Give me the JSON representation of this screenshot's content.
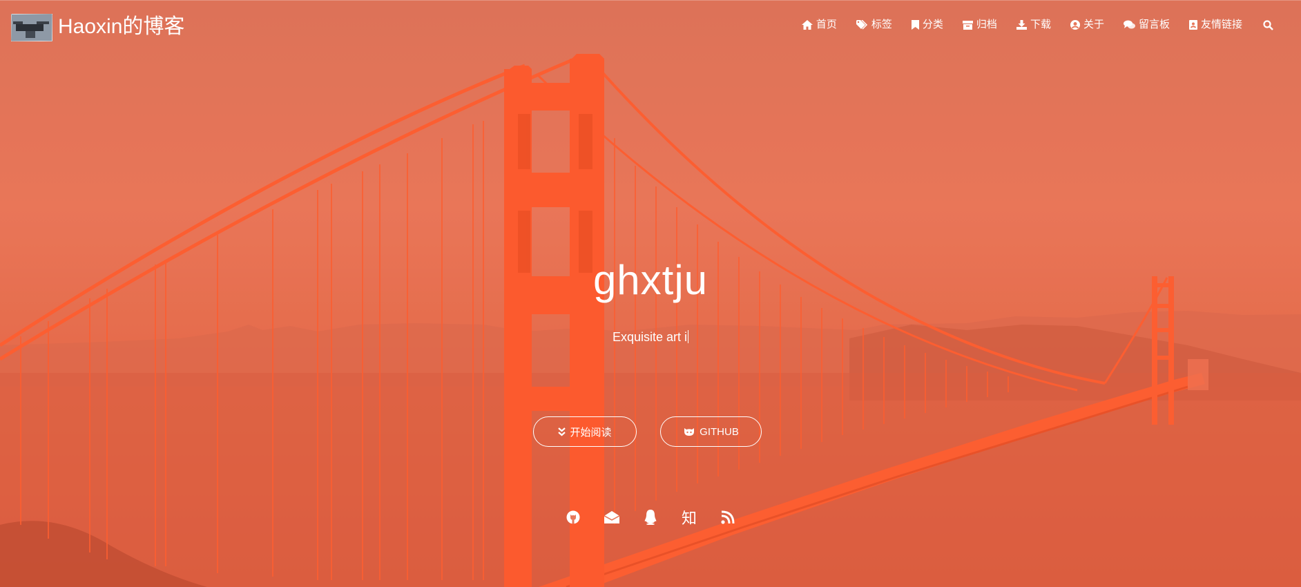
{
  "site": {
    "title": "Haoxin的博客"
  },
  "nav": {
    "items": [
      {
        "label": "首页",
        "icon": "home-icon"
      },
      {
        "label": "标签",
        "icon": "tags-icon"
      },
      {
        "label": "分类",
        "icon": "bookmark-icon"
      },
      {
        "label": "归档",
        "icon": "archive-icon"
      },
      {
        "label": "下载",
        "icon": "download-icon"
      },
      {
        "label": "关于",
        "icon": "user-circle-icon"
      },
      {
        "label": "留言板",
        "icon": "comments-icon"
      },
      {
        "label": "友情链接",
        "icon": "address-book-icon"
      }
    ],
    "search_icon": "search-icon"
  },
  "hero": {
    "headline": "ghxtju",
    "tagline": "Exquisite art i",
    "buttons": {
      "read_label": "开始阅读",
      "github_label": "GITHUB"
    },
    "socials": [
      {
        "icon": "github-icon"
      },
      {
        "icon": "email-icon"
      },
      {
        "icon": "qq-icon"
      },
      {
        "icon": "zhihu-icon",
        "text": "知"
      },
      {
        "icon": "rss-icon"
      }
    ]
  },
  "colors": {
    "overlay": "#e8775a",
    "bridge": "#ff5a2a",
    "text": "#ffffff"
  }
}
